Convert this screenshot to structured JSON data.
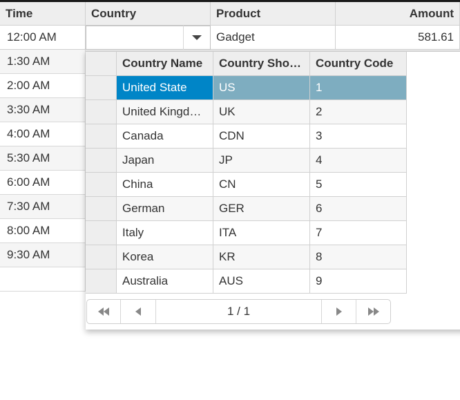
{
  "grid": {
    "columns": [
      {
        "label": "Time"
      },
      {
        "label": "Country"
      },
      {
        "label": "Product"
      },
      {
        "label": "Amount"
      }
    ],
    "edit_row": {
      "time": "12:00 AM",
      "country": "",
      "product": "Gadget",
      "amount": "581.61"
    },
    "times": [
      "1:30 AM",
      "2:00 AM",
      "3:30 AM",
      "4:00 AM",
      "5:30 AM",
      "6:00 AM",
      "7:30 AM",
      "8:00 AM",
      "9:30 AM",
      ""
    ]
  },
  "dropdown": {
    "headers": [
      "Country Name",
      "Country Sho…",
      "Country Code"
    ],
    "rows": [
      {
        "name": "United State",
        "short": "US",
        "code": "1"
      },
      {
        "name": "United Kingd…",
        "short": "UK",
        "code": "2"
      },
      {
        "name": "Canada",
        "short": "CDN",
        "code": "3"
      },
      {
        "name": "Japan",
        "short": "JP",
        "code": "4"
      },
      {
        "name": "China",
        "short": "CN",
        "code": "5"
      },
      {
        "name": "German",
        "short": "GER",
        "code": "6"
      },
      {
        "name": "Italy",
        "short": "ITA",
        "code": "7"
      },
      {
        "name": "Korea",
        "short": "KR",
        "code": "8"
      },
      {
        "name": "Australia",
        "short": "AUS",
        "code": "9"
      }
    ],
    "selected_index": 0,
    "pager": {
      "info": "1 / 1"
    }
  }
}
